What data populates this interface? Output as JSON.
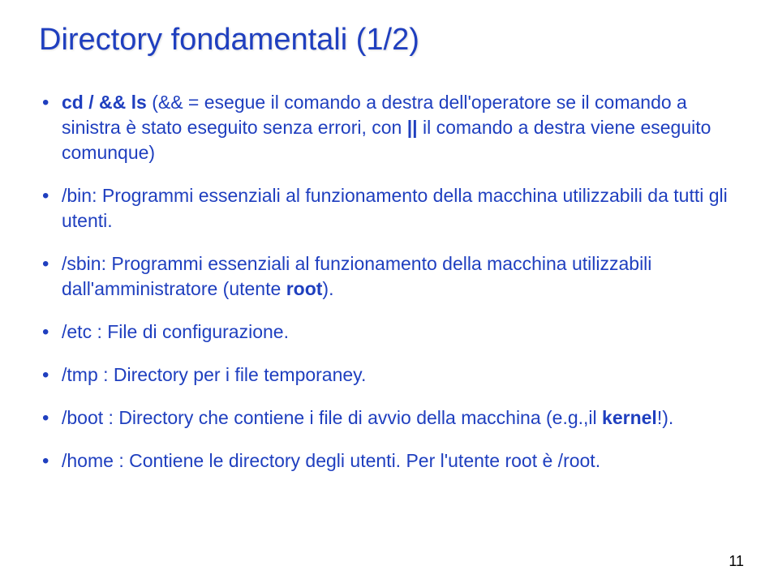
{
  "title": "Directory fondamentali (1/2)",
  "bullets": [
    "<b>cd / && ls</b> (&& = esegue il comando a destra dell'operatore se il comando a sinistra è stato eseguito senza errori, con <b>||</b> il comando a destra viene eseguito comunque)",
    "/bin: Programmi essenziali al funzionamento della macchina utilizzabili da tutti gli utenti.",
    "/sbin: Programmi essenziali al funzionamento della macchina utilizzabili dall'amministratore (utente <b>root</b>).",
    "/etc : File di configurazione.",
    "/tmp : Directory per i file temporaney.",
    "/boot : Directory che contiene i file di avvio della macchina (e.g.,il <b>kernel</b>!).",
    "/home : Contiene le directory degli utenti. Per l'utente root è /root."
  ],
  "page_number": "11"
}
